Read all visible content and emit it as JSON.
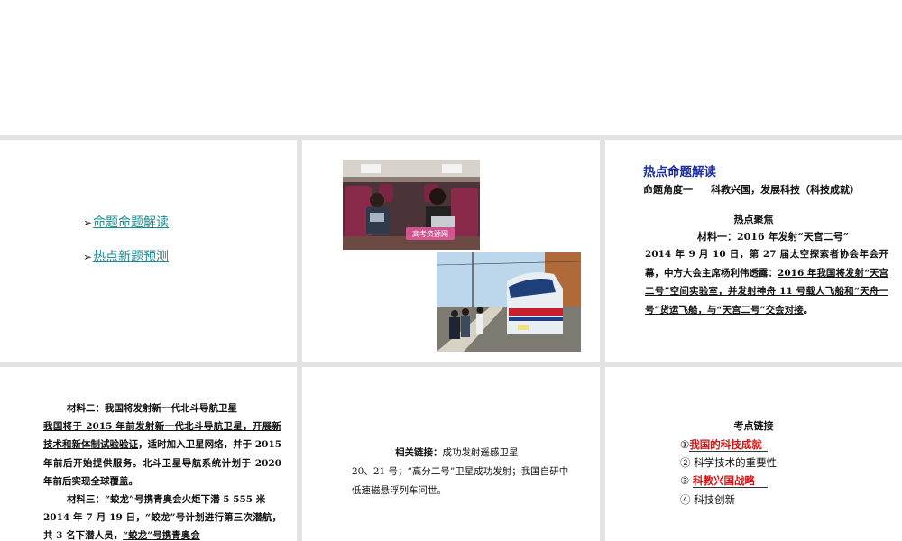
{
  "slide1": {
    "items": [
      {
        "arrow": "➢",
        "label": "命题命题解读"
      },
      {
        "arrow": "➢",
        "label": "热点新题预测"
      }
    ]
  },
  "slide2": {
    "watermark": "高考资源网"
  },
  "slide3": {
    "title": "热点命题解读",
    "subtitle_a": "命题角度一",
    "subtitle_b": "科教兴国，发展科技（科技成就）",
    "focus": "热点聚焦",
    "material_heading": "材料一：2016 年发射“天宫二号”",
    "body_plain": "2014 年 9 月 10 日，第 27 届太空探索者协会年会开幕，中方大会主席杨利伟透露：",
    "body_underlined": "2016 年我国将发射“天宫二号”空间实验室，并发射神舟 11 号载人飞船和“天舟一号”货运飞船，与“天宫二号”交会对接",
    "body_end": "。"
  },
  "slide4": {
    "heading2": "材料二：我国将发射新一代北斗导航卫星",
    "body2_underlined": "我国将于 2015 年前发射新一代北斗导航卫星，开展新技术和新体制试验验证",
    "body2_plain": "，适时加入卫星网络，并于 2015 年前后开始提供服务。北斗卫星导航系统计划于 2020 年前后实现全球覆盖。",
    "heading3": "材料三：“蛟龙”号携青奥会火炬下潜 5 555 米",
    "body3_plain": "2014 年 7 月 19 日，“蛟龙”号计划进行第三次潜航，共 3 名下潜人员，",
    "body3_underlined": "“蛟龙”号携青奥会"
  },
  "slide5": {
    "label": "相关链接：",
    "text1": "成功发射遥感卫星",
    "text2": "20、21 号；“高分二号”卫星成功发射；我国自研中低速磁悬浮列车问世。"
  },
  "slide6": {
    "title": "考点链接",
    "points": [
      {
        "num": "①",
        "text": "我国的科技成就"
      },
      {
        "num": "②",
        "text": "科学技术的重要性"
      },
      {
        "num": "③",
        "text": "科教兴国战略"
      },
      {
        "num": "④",
        "text": "科技创新"
      }
    ]
  },
  "colors": {
    "link": "#1a8a92",
    "title_blue": "#1a2ea8",
    "highlight_red": "#d01414",
    "divider_gray": "#e3e3e3"
  }
}
